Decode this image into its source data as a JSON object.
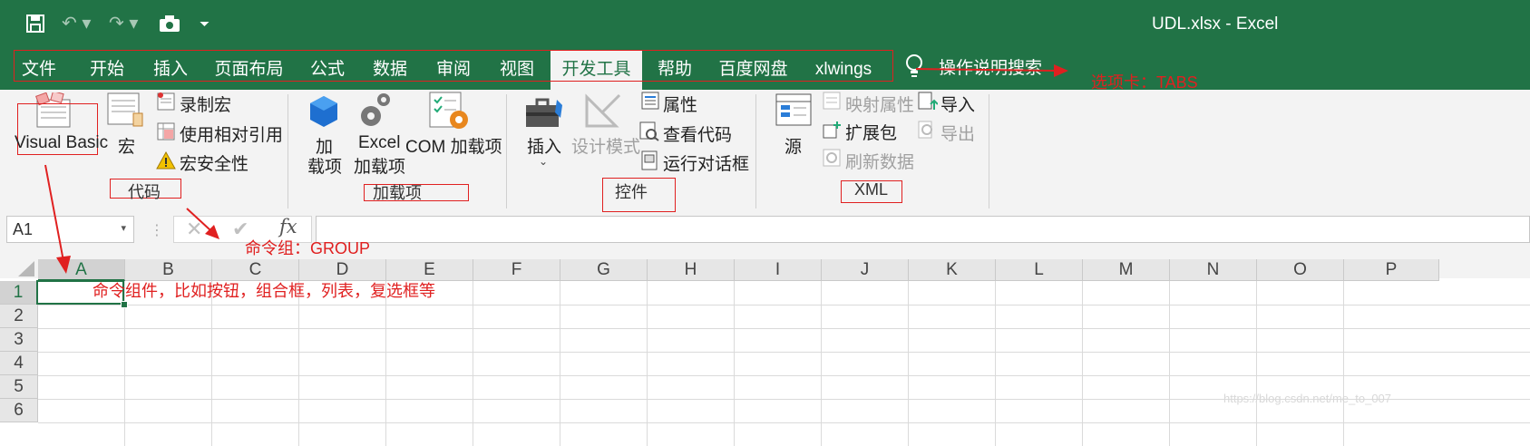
{
  "window": {
    "title": "UDL.xlsx  -  Excel"
  },
  "tabs": [
    {
      "label": "文件"
    },
    {
      "label": "开始"
    },
    {
      "label": "插入"
    },
    {
      "label": "页面布局"
    },
    {
      "label": "公式"
    },
    {
      "label": "数据"
    },
    {
      "label": "审阅"
    },
    {
      "label": "视图"
    },
    {
      "label": "开发工具"
    },
    {
      "label": "帮助"
    },
    {
      "label": "百度网盘"
    },
    {
      "label": "xlwings"
    }
  ],
  "tell_me": "操作说明搜索",
  "ribbon": {
    "code": {
      "visual_basic": "Visual Basic",
      "macros": "宏",
      "record_macro": "录制宏",
      "relative_refs": "使用相对引用",
      "macro_security": "宏安全性",
      "group": "代码"
    },
    "addins": {
      "addins": "加\n载项",
      "addins_line1": "加",
      "addins_line2": "载项",
      "excel_addins_line1": "Excel",
      "excel_addins_line2": "加载项",
      "com_addins": "COM 加载项",
      "group": "加载项"
    },
    "controls": {
      "insert": "插入",
      "design_mode": "设计模式",
      "properties": "属性",
      "view_code": "查看代码",
      "run_dialog": "运行对话框",
      "group": "控件"
    },
    "xml": {
      "source": "源",
      "map_properties": "映射属性",
      "expansion_packs": "扩展包",
      "refresh_data": "刷新数据",
      "import": "导入",
      "export": "导出",
      "group": "XML"
    }
  },
  "formula_bar": {
    "name_box": "A1",
    "fx": "fx"
  },
  "grid": {
    "columns": [
      "A",
      "B",
      "C",
      "D",
      "E",
      "F",
      "G",
      "H",
      "I",
      "J",
      "K",
      "L",
      "M",
      "N",
      "O",
      "P"
    ],
    "rows": [
      "1",
      "2",
      "3",
      "4",
      "5",
      "6"
    ]
  },
  "annotations": {
    "tabs": "选项卡：TABS",
    "group": "命令组：GROUP",
    "commands": "命令组件，比如按钮，组合框，列表，复选框等"
  },
  "watermark": "https://blog.csdn.net/me_to_007",
  "colors": {
    "excel_green": "#217346",
    "annotation_red": "#e02020"
  }
}
